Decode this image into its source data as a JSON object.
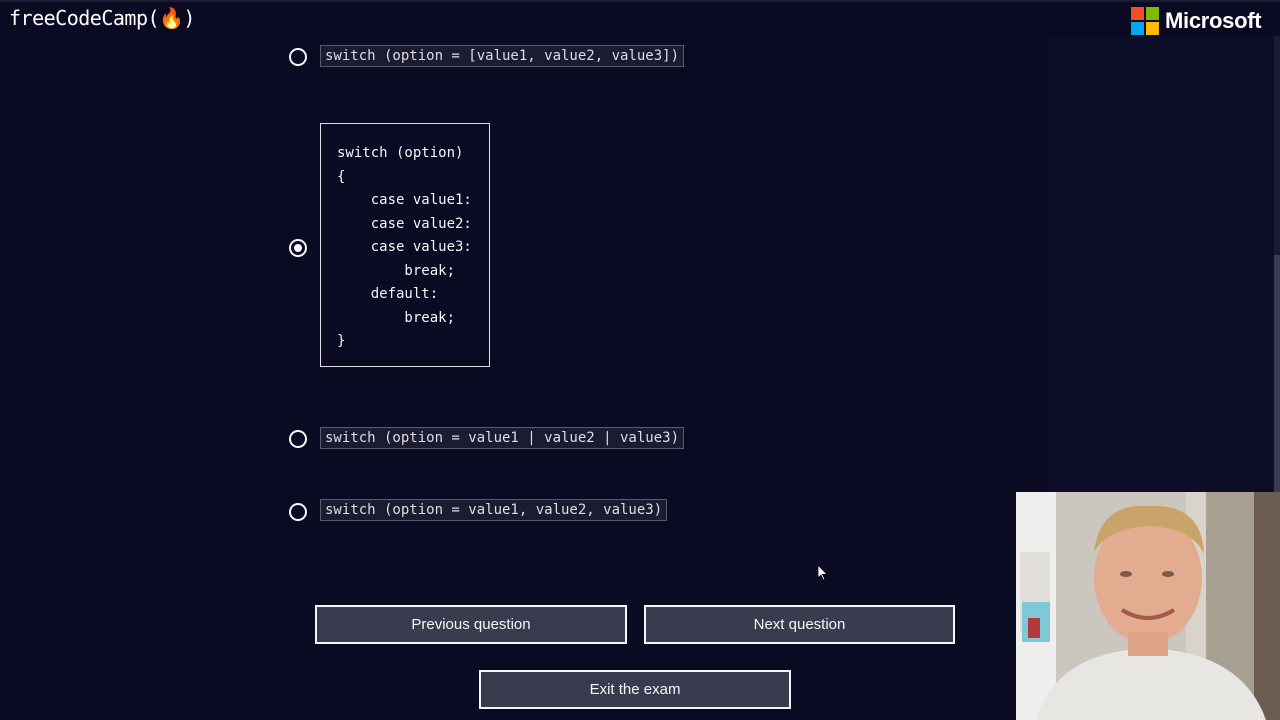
{
  "header": {
    "brand_left": "freeCodeCamp(🔥)",
    "brand_right": "Microsoft",
    "brand_right_icon": "microsoft-logo-icon",
    "ms_colors": [
      "#f25022",
      "#7fba00",
      "#00a4ef",
      "#ffb900"
    ]
  },
  "question": {
    "options": [
      {
        "label": "switch (option = [value1, value2, value3])",
        "selected": false
      },
      {
        "label": "switch (option)\n{\n    case value1:\n    case value2:\n    case value3:\n        break;\n    default:\n        break;\n}",
        "selected": true
      },
      {
        "label": "switch (option = value1 | value2 | value3)",
        "selected": false
      },
      {
        "label": "switch (option = value1, value2, value3)",
        "selected": false
      }
    ]
  },
  "nav": {
    "previous_label": "Previous question",
    "next_label": "Next question",
    "exit_label": "Exit the exam"
  },
  "colors": {
    "background": "#0a0a23",
    "button_bg": "#3b3b4f",
    "text": "#f5f6f7"
  }
}
